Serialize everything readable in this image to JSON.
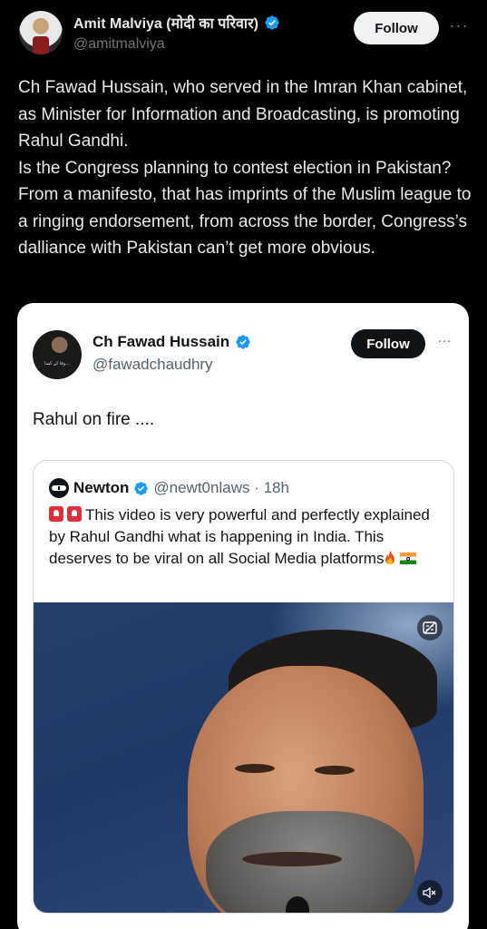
{
  "main_tweet": {
    "display_name": "Amit Malviya (मोदी का परिवार)",
    "handle": "@amitmalviya",
    "follow_label": "Follow",
    "more_label": "···",
    "text_lines": [
      "Ch Fawad Hussain, who served in the Imran Khan cabinet, as Minister for Information and Broadcasting, is promoting Rahul Gandhi.",
      "Is the Congress planning to contest election in Pakistan? From a manifesto, that has imprints of the Muslim league to a ringing endorsement, from across the border, Congress’s dalliance with Pakistan can’t get more obvious."
    ]
  },
  "quoted_tweet": {
    "display_name": "Ch Fawad Hussain",
    "handle": "@fawadchaudhry",
    "follow_label": "Follow",
    "more_label": "···",
    "text": "Rahul on fire ...."
  },
  "nested_quote": {
    "display_name": "Newton",
    "handle_time": "@newt0nlaws · 18h",
    "text": "This video is very powerful and perfectly explained by Rahul Gandhi what is happening in India. This deserves to be viral on all Social Media platforms"
  },
  "colors": {
    "verified": "#1d9bf0",
    "background": "#000000",
    "card": "#ffffff"
  },
  "icons": [
    "verified-badge-icon",
    "more-icon",
    "siren-icon",
    "fire-icon",
    "india-flag-icon",
    "caption-icon",
    "mute-icon"
  ]
}
